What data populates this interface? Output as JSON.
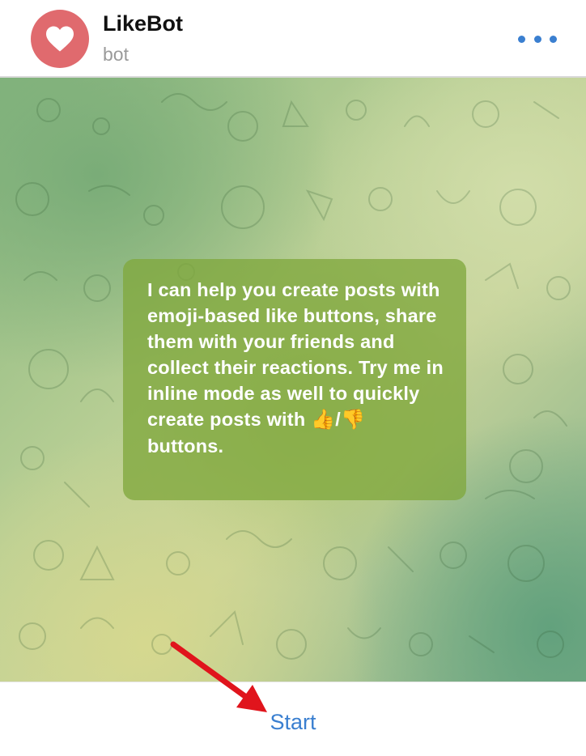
{
  "header": {
    "title": "LikeBot",
    "subtitle": "bot",
    "avatar_icon": "heart-icon",
    "avatar_color": "#e06a6e",
    "menu_icon": "more-horizontal-icon"
  },
  "chat": {
    "background": "green-yellow gradient with doodle pattern",
    "message": {
      "line1": "I can help you create posts with emoji-based like buttons, share them with your friends and collect their reactions. Try me in inline mode as well to quickly create posts with ",
      "emoji_up": "👍",
      "separator": "/",
      "emoji_down": "👎",
      "line2": " buttons."
    }
  },
  "bottom": {
    "start_label": "Start",
    "accent_color": "#3a7fd0"
  },
  "annotation": {
    "arrow_color": "#e0141c"
  }
}
